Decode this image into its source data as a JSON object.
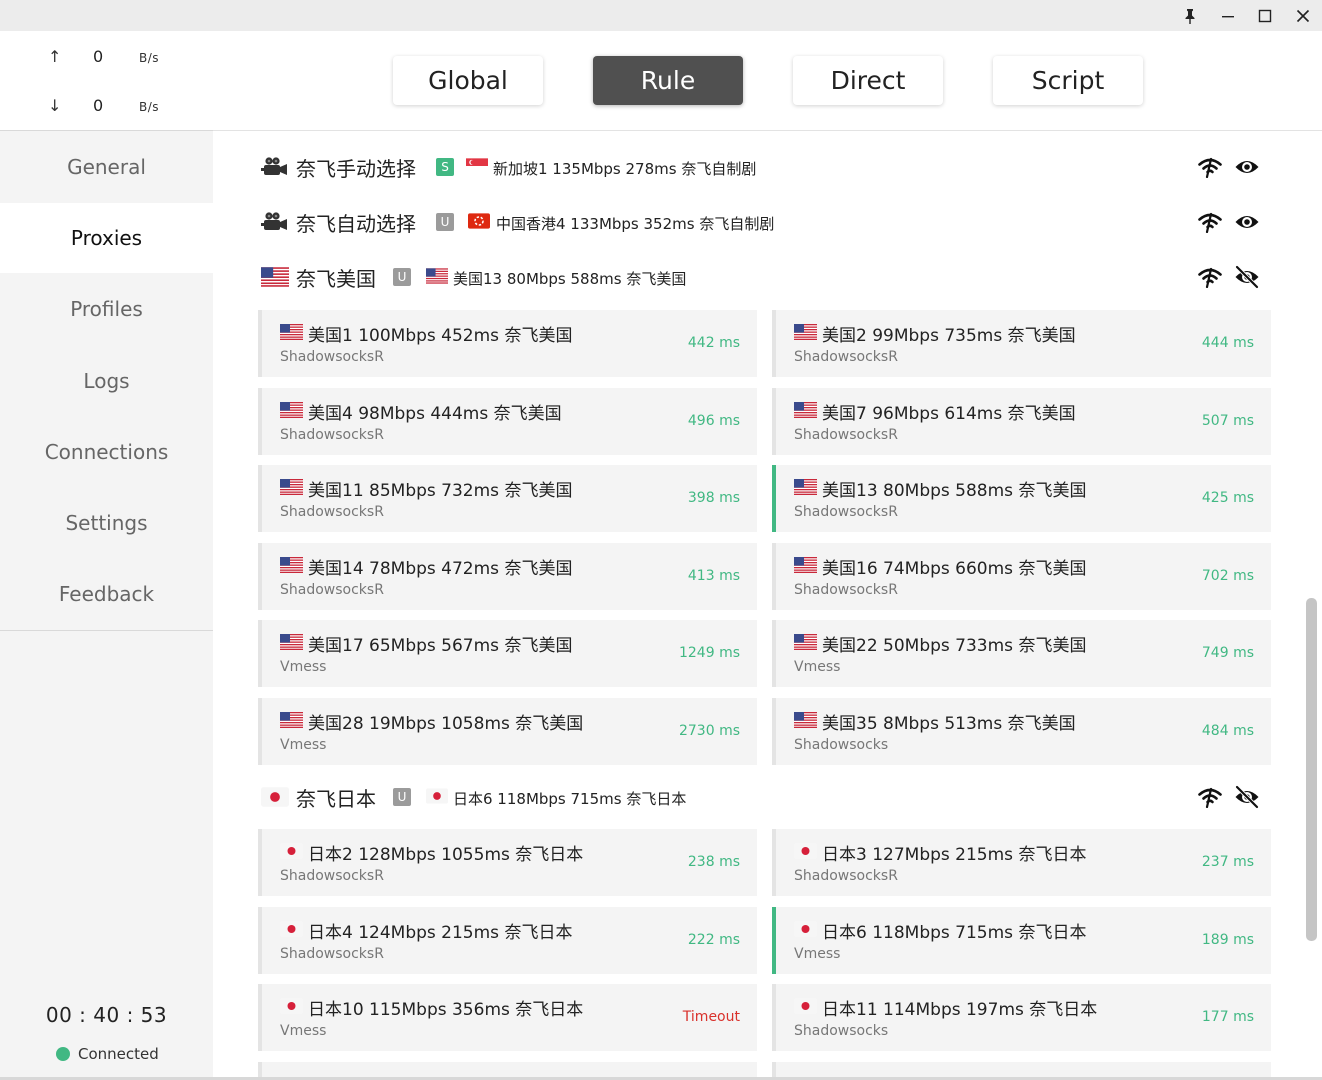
{
  "window": {
    "pin_icon": "pin-icon",
    "minimize_icon": "minimize-icon",
    "maximize_icon": "maximize-icon",
    "close_icon": "close-icon"
  },
  "traffic": {
    "up_arrow": "↑",
    "up_value": "0",
    "up_unit": "B/s",
    "down_arrow": "↓",
    "down_value": "0",
    "down_unit": "B/s"
  },
  "nav": {
    "general": "General",
    "proxies": "Proxies",
    "profiles": "Profiles",
    "logs": "Logs",
    "connections": "Connections",
    "settings": "Settings",
    "feedback": "Feedback"
  },
  "footer": {
    "timer": "00 : 40 : 53",
    "status": "Connected",
    "status_color": "#41b883"
  },
  "modes": {
    "global": "Global",
    "rule": "Rule",
    "direct": "Direct",
    "script": "Script",
    "active": "Rule"
  },
  "colors": {
    "accent": "#41b883",
    "active_mode_bg": "#505050",
    "timeout": "#d9312b"
  },
  "groups": {
    "manual": {
      "icon": "movie-camera-icon",
      "name": "奈飞手动选择",
      "badge": "S",
      "selected_flag": "singapore-flag",
      "selected": "新加坡1 135Mbps 278ms 奈飞自制剧",
      "test_icon": "latency-test-icon",
      "visibility_icon": "eye-icon"
    },
    "auto": {
      "icon": "movie-camera-icon",
      "name": "奈飞自动选择",
      "badge": "U",
      "selected_flag": "hong-kong-flag",
      "selected": "中国香港4 133Mbps 352ms 奈飞自制剧",
      "test_icon": "latency-test-icon",
      "visibility_icon": "eye-icon"
    },
    "us": {
      "icon": "us-flag",
      "name": "奈飞美国",
      "badge": "U",
      "selected_flag": "us-flag",
      "selected": "美国13 80Mbps 588ms 奈飞美国",
      "test_icon": "latency-test-icon",
      "visibility_icon": "eye-off-icon",
      "proxies": [
        {
          "name": "美国1 100Mbps 452ms 奈飞美国",
          "type": "ShadowsocksR",
          "latency": "442 ms",
          "selected": false
        },
        {
          "name": "美国2 99Mbps 735ms 奈飞美国",
          "type": "ShadowsocksR",
          "latency": "444 ms",
          "selected": false
        },
        {
          "name": "美国4 98Mbps 444ms 奈飞美国",
          "type": "ShadowsocksR",
          "latency": "496 ms",
          "selected": false
        },
        {
          "name": "美国7 96Mbps 614ms 奈飞美国",
          "type": "ShadowsocksR",
          "latency": "507 ms",
          "selected": false
        },
        {
          "name": "美国11 85Mbps 732ms 奈飞美国",
          "type": "ShadowsocksR",
          "latency": "398 ms",
          "selected": false
        },
        {
          "name": "美国13 80Mbps 588ms 奈飞美国",
          "type": "ShadowsocksR",
          "latency": "425 ms",
          "selected": true
        },
        {
          "name": "美国14 78Mbps 472ms 奈飞美国",
          "type": "ShadowsocksR",
          "latency": "413 ms",
          "selected": false
        },
        {
          "name": "美国16 74Mbps 660ms 奈飞美国",
          "type": "ShadowsocksR",
          "latency": "702 ms",
          "selected": false
        },
        {
          "name": "美国17 65Mbps 567ms 奈飞美国",
          "type": "Vmess",
          "latency": "1249 ms",
          "selected": false
        },
        {
          "name": "美国22 50Mbps 733ms 奈飞美国",
          "type": "Vmess",
          "latency": "749 ms",
          "selected": false
        },
        {
          "name": "美国28 19Mbps 1058ms 奈飞美国",
          "type": "Vmess",
          "latency": "2730 ms",
          "selected": false
        },
        {
          "name": "美国35 8Mbps 513ms 奈飞美国",
          "type": "Shadowsocks",
          "latency": "484 ms",
          "selected": false
        }
      ]
    },
    "jp": {
      "icon": "japan-flag",
      "name": "奈飞日本",
      "badge": "U",
      "selected_flag": "japan-flag",
      "selected": "日本6 118Mbps 715ms 奈飞日本",
      "test_icon": "latency-test-icon",
      "visibility_icon": "eye-off-icon",
      "proxies": [
        {
          "name": "日本2 128Mbps 1055ms 奈飞日本",
          "type": "ShadowsocksR",
          "latency": "238 ms",
          "selected": false
        },
        {
          "name": "日本3 127Mbps 215ms 奈飞日本",
          "type": "ShadowsocksR",
          "latency": "237 ms",
          "selected": false
        },
        {
          "name": "日本4 124Mbps 215ms 奈飞日本",
          "type": "ShadowsocksR",
          "latency": "222 ms",
          "selected": false
        },
        {
          "name": "日本6 118Mbps 715ms 奈飞日本",
          "type": "Vmess",
          "latency": "189 ms",
          "selected": true
        },
        {
          "name": "日本10 115Mbps 356ms 奈飞日本",
          "type": "Vmess",
          "latency": "Timeout",
          "selected": false
        },
        {
          "name": "日本11 114Mbps 197ms 奈飞日本",
          "type": "Shadowsocks",
          "latency": "177 ms",
          "selected": false
        }
      ]
    }
  }
}
